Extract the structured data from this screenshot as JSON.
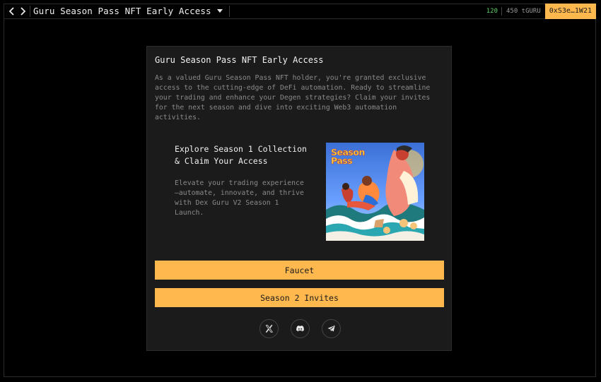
{
  "header": {
    "title": "Guru Season Pass NFT Early Access",
    "stat_green": "120",
    "balance": "450 tGURU",
    "wallet": "0xS3e…1W21"
  },
  "card": {
    "title": "Guru Season Pass NFT Early Access",
    "description": "As a valued Guru Season Pass NFT holder, you're granted exclusive access to the cutting-edge of DeFi automation. Ready to streamline your trading and enhance your Degen strategies? Claim your invites for the next season and dive into exciting Web3 automation activities.",
    "explore_title": "Explore Season 1 Collection & Claim Your Access",
    "explore_desc": "Elevate your trading experience —automate, innovate, and thrive with Dex Guru V2 Season 1 Launch.",
    "image_text": "Season Pass",
    "faucet_label": "Faucet",
    "invites_label": "Season 2 Invites"
  },
  "social": [
    "x-icon",
    "discord-icon",
    "telegram-icon"
  ],
  "colors": {
    "accent": "#ffb84d",
    "background": "#000000",
    "card": "#1b1b1b",
    "positive": "#5fd068"
  }
}
